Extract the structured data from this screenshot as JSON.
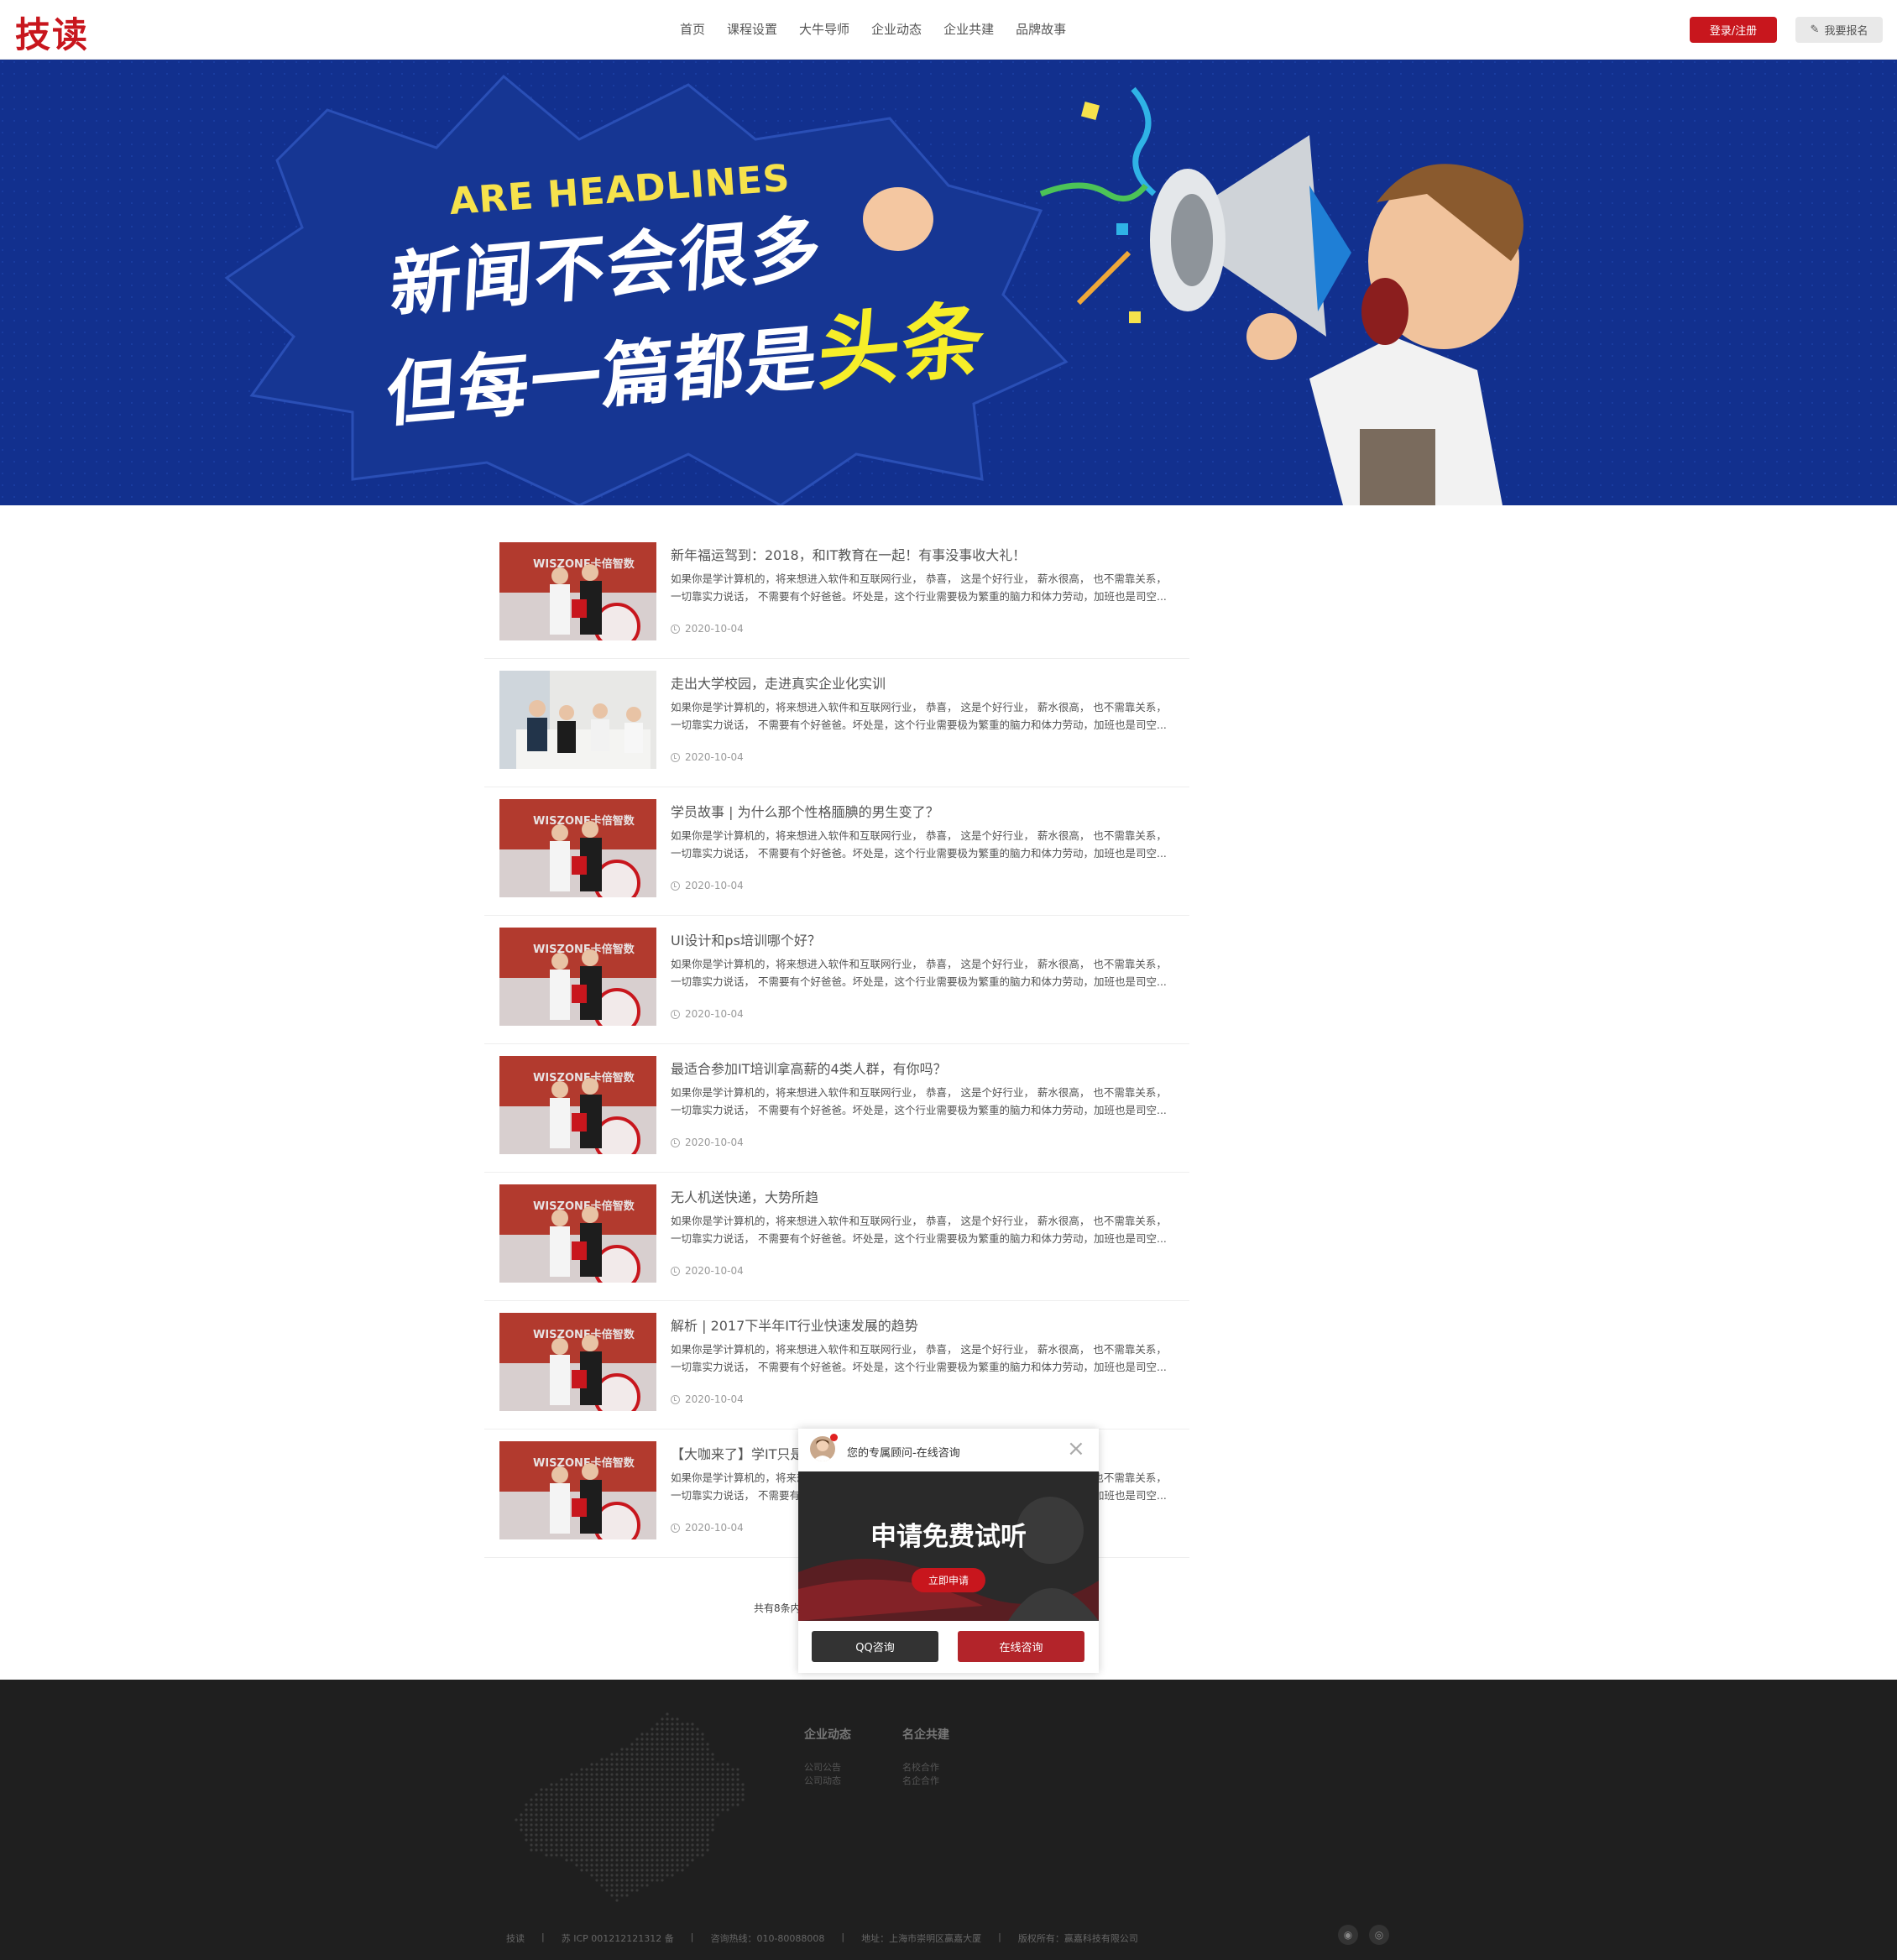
{
  "header": {
    "logo": "技读",
    "nav": [
      "首页",
      "课程设置",
      "大牛导师",
      "企业动态",
      "企业共建",
      "品牌故事"
    ],
    "login_label": "登录/注册",
    "signup_label": "我要报名"
  },
  "banner": {
    "english": "ARE HEADLINES",
    "line1": "新闻不会很多",
    "line2_prefix": "但每一篇都是",
    "line2_highlight": "头条"
  },
  "articles": [
    {
      "title": "新年福运驾到：2018，和IT教育在一起！有事没事收大礼！",
      "desc1": "如果你是学计算机的，将来想进入软件和互联网行业， 恭喜， 这是个好行业， 薪水很高， 也不需靠关系，",
      "desc2": "一切靠实力说话， 不需要有个好爸爸。坏处是，这个行业需要极为繁重的脑力和体力劳动，加班也是司空...",
      "date": "2020-10-04"
    },
    {
      "title": "走出大学校园，走进真实企业化实训",
      "desc1": "如果你是学计算机的，将来想进入软件和互联网行业， 恭喜， 这是个好行业， 薪水很高， 也不需靠关系，",
      "desc2": "一切靠实力说话， 不需要有个好爸爸。坏处是，这个行业需要极为繁重的脑力和体力劳动，加班也是司空...",
      "date": "2020-10-04"
    },
    {
      "title": "学员故事 | 为什么那个性格腼腆的男生变了？",
      "desc1": "如果你是学计算机的，将来想进入软件和互联网行业， 恭喜， 这是个好行业， 薪水很高， 也不需靠关系，",
      "desc2": "一切靠实力说话， 不需要有个好爸爸。坏处是，这个行业需要极为繁重的脑力和体力劳动，加班也是司空...",
      "date": "2020-10-04"
    },
    {
      "title": "UI设计和ps培训哪个好？",
      "desc1": "如果你是学计算机的，将来想进入软件和互联网行业， 恭喜， 这是个好行业， 薪水很高， 也不需靠关系，",
      "desc2": "一切靠实力说话， 不需要有个好爸爸。坏处是，这个行业需要极为繁重的脑力和体力劳动，加班也是司空...",
      "date": "2020-10-04"
    },
    {
      "title": "最适合参加IT培训拿高薪的4类人群，有你吗？",
      "desc1": "如果你是学计算机的，将来想进入软件和互联网行业， 恭喜， 这是个好行业， 薪水很高， 也不需靠关系，",
      "desc2": "一切靠实力说话， 不需要有个好爸爸。坏处是，这个行业需要极为繁重的脑力和体力劳动，加班也是司空...",
      "date": "2020-10-04"
    },
    {
      "title": "无人机送快递，大势所趋",
      "desc1": "如果你是学计算机的，将来想进入软件和互联网行业， 恭喜， 这是个好行业， 薪水很高， 也不需靠关系，",
      "desc2": "一切靠实力说话， 不需要有个好爸爸。坏处是，这个行业需要极为繁重的脑力和体力劳动，加班也是司空...",
      "date": "2020-10-04"
    },
    {
      "title": "解析 | 2017下半年IT行业快速发展的趋势",
      "desc1": "如果你是学计算机的，将来想进入软件和互联网行业， 恭喜， 这是个好行业， 薪水很高， 也不需靠关系，",
      "desc2": "一切靠实力说话， 不需要有个好爸爸。坏处是，这个行业需要极为繁重的脑力和体力劳动，加班也是司空...",
      "date": "2020-10-04"
    },
    {
      "title": "【大咖来了】学IT只是",
      "desc1": "如果你是学计算机的，将来想进入软件和互联网行业， 恭喜， 这是个好行业， 薪水很高， 也不需靠关系，",
      "desc2": "一切靠实力说话， 不需要有个好爸爸。坏处是，这个行业需要极为繁重的脑力和体力劳动，加班也是司空...",
      "date": "2020-10-04"
    }
  ],
  "thumb_text": "WISZONE卡倍智数",
  "pager": "共有8条内",
  "popup": {
    "title": "您的专属顾问-在线咨询",
    "heading": "申请免费试听",
    "apply_label": "立即申请",
    "qq_label": "QQ咨询",
    "online_label": "在线咨询"
  },
  "footer": {
    "col1": {
      "title": "企业动态",
      "links": [
        "公司公告",
        "公司动态"
      ]
    },
    "col2": {
      "title": "名企共建",
      "links": [
        "名校合作",
        "名企合作"
      ]
    },
    "bottom": [
      "技读",
      "苏 ICP 001212121312 备",
      "咨询热线：010-80088008",
      "地址：上海市崇明区赢嘉大厦",
      "版权所有：赢嘉科技有限公司"
    ]
  },
  "colors": {
    "brand_red": "#c8161d",
    "banner_blue": "#12308e",
    "footer_bg": "#1f1f1f"
  }
}
